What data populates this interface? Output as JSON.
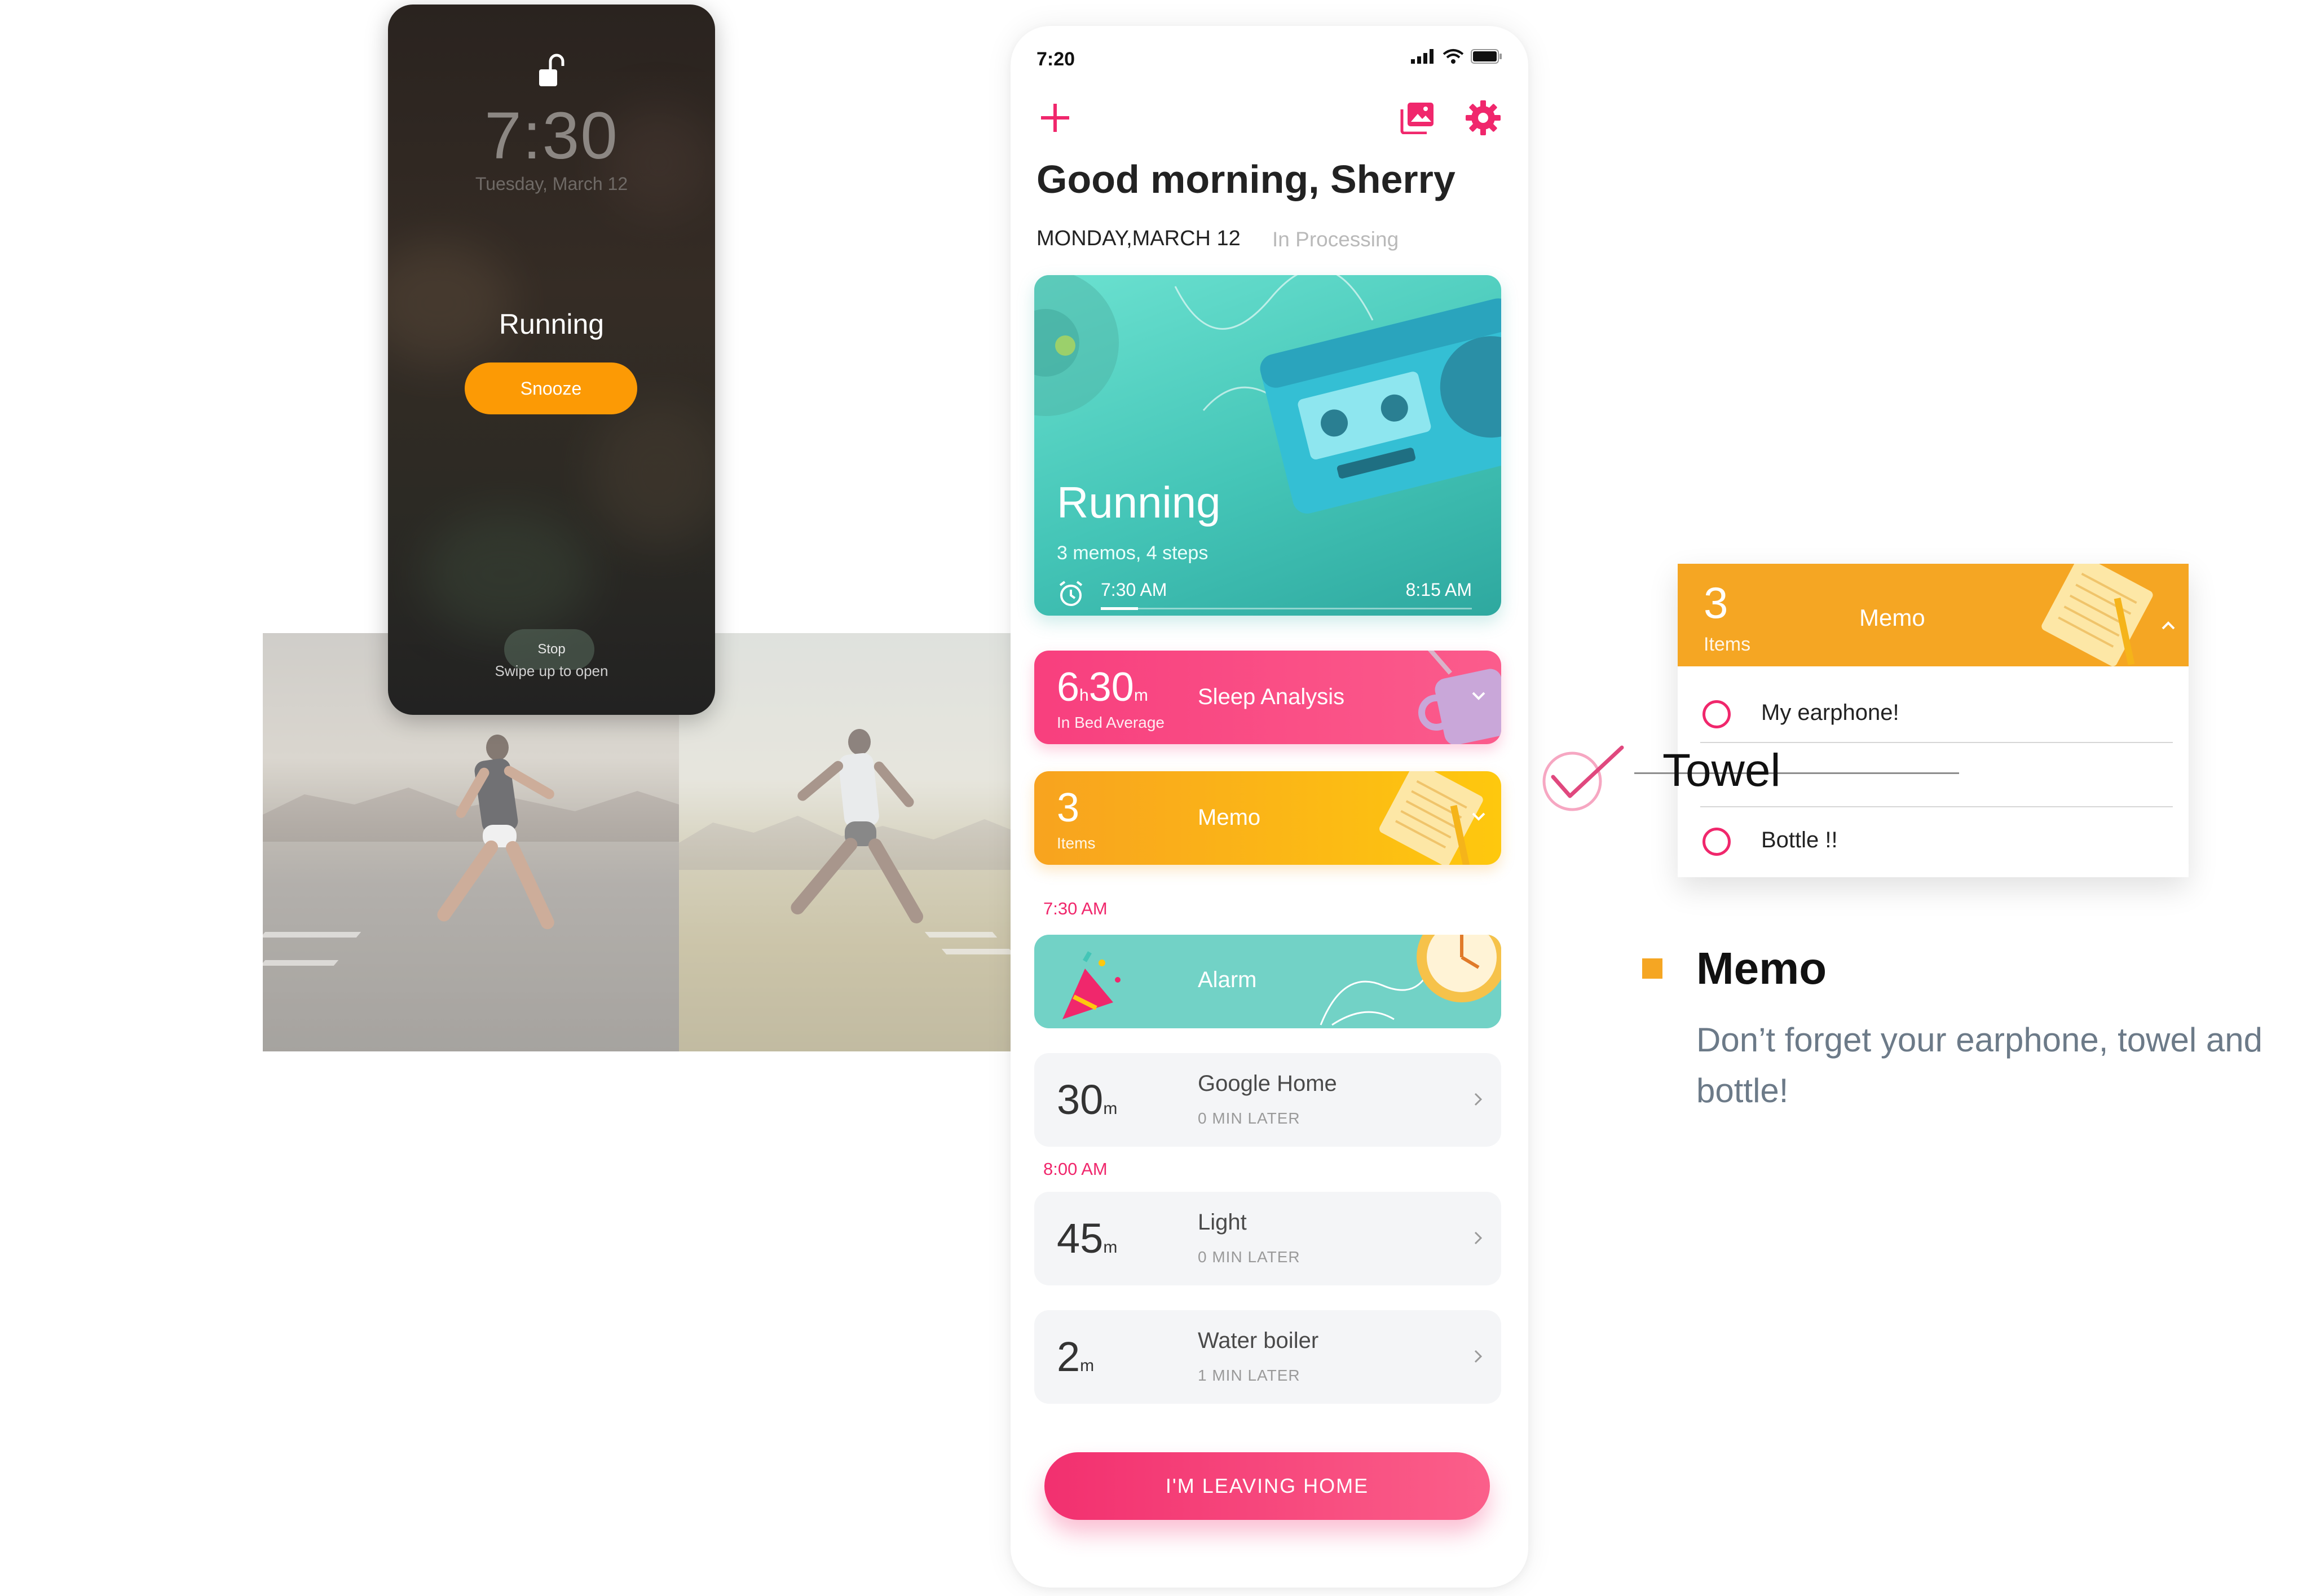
{
  "lock_screen": {
    "time": "7:30",
    "date": "Tuesday, March 12",
    "title": "Running",
    "snooze_label": "Snooze",
    "stop_label": "Stop",
    "swipe_label": "Swipe up to open"
  },
  "app": {
    "status_time": "7:20",
    "greeting": "Good morning, Sherry",
    "date_line": "MONDAY,MARCH 12",
    "status_text": "In Processing",
    "running_card": {
      "title": "Running",
      "subtitle": "3 memos, 4 steps",
      "start_time": "7:30 AM",
      "end_time": "8:15 AM",
      "progress": 0.1
    },
    "sleep_card": {
      "hours": "6",
      "hours_unit": "h",
      "minutes": "30",
      "minutes_unit": "m",
      "sub": "In Bed Average",
      "label": "Sleep Analysis"
    },
    "memo_card": {
      "count": "3",
      "sub": "Items",
      "label": "Memo"
    },
    "section_1_time": "7:30 AM",
    "alarm_card": {
      "label": "Alarm"
    },
    "tasks_1": [
      {
        "num": "30",
        "unit": "m",
        "title": "Google Home",
        "sub": "0 MIN LATER"
      }
    ],
    "section_2_time": "8:00 AM",
    "tasks_2": [
      {
        "num": "45",
        "unit": "m",
        "title": "Light",
        "sub": "0 MIN LATER"
      },
      {
        "num": "2",
        "unit": "m",
        "title": "Water boiler",
        "sub": "1 MIN LATER"
      }
    ],
    "leave_button": "I'M LEAVING HOME"
  },
  "memo_detail": {
    "count": "3",
    "sub": "Items",
    "label": "Memo",
    "items": [
      "My earphone!",
      "Towel",
      "Bottle !!"
    ],
    "heading": "Memo",
    "description": "Don’t forget your earphone, towel and bottle!"
  },
  "colors": {
    "accent_pink": "#f0276c",
    "accent_orange": "#f5a623",
    "teal": "#44c5b7",
    "snooze_orange": "#fc9a05"
  },
  "icons": [
    "unlock-icon",
    "add-icon",
    "gallery-icon",
    "gear-icon",
    "alarm-clock-icon",
    "chevron-down-icon",
    "chevron-right-icon",
    "chevron-up-icon",
    "check-icon"
  ]
}
